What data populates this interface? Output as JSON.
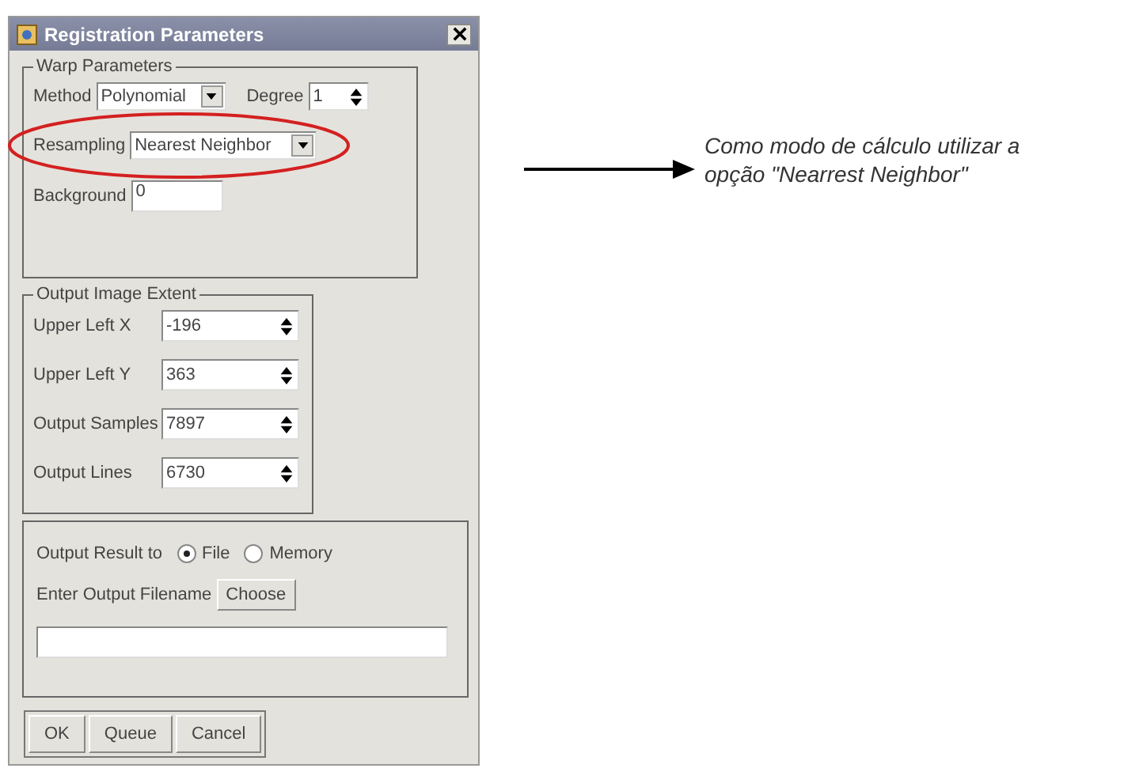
{
  "dialog": {
    "title": "Registration Parameters",
    "warp": {
      "legend": "Warp Parameters",
      "method": {
        "label": "Method",
        "value": "Polynomial"
      },
      "degree": {
        "label": "Degree",
        "value": "1"
      },
      "resampling": {
        "label": "Resampling",
        "value": "Nearest Neighbor",
        "highlighted": true
      },
      "background": {
        "label": "Background",
        "value": "0"
      }
    },
    "extent": {
      "legend": "Output Image Extent",
      "fields": [
        {
          "label": "Upper Left X",
          "value": "-196"
        },
        {
          "label": "Upper Left Y",
          "value": "363"
        },
        {
          "label": "Output Samples",
          "value": "7897"
        },
        {
          "label": "Output Lines",
          "value": "6730"
        }
      ]
    },
    "output": {
      "label": "Output Result to",
      "options": [
        {
          "label": "File",
          "selected": true
        },
        {
          "label": "Memory",
          "selected": false
        }
      ],
      "filename_label": "Enter Output Filename",
      "choose": "Choose"
    },
    "buttons": [
      "OK",
      "Queue",
      "Cancel"
    ]
  },
  "annotation": {
    "lines": [
      "Como modo de cálculo utilizar a",
      "opção \"Nearrest Neighbor\""
    ]
  }
}
